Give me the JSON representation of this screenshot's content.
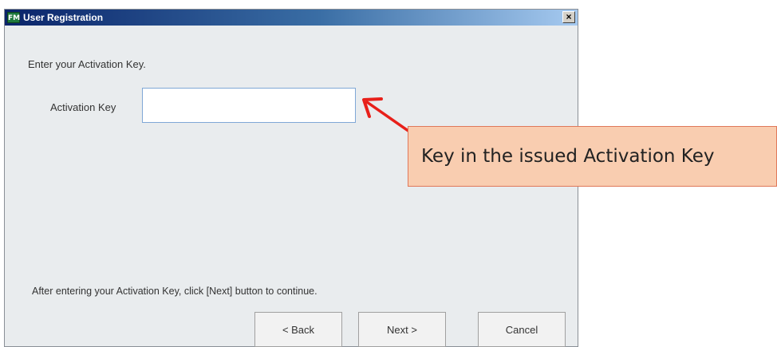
{
  "window": {
    "title": "User Registration",
    "app_icon_text": "FM",
    "close_glyph": "×"
  },
  "instruction": "Enter your Activation Key.",
  "activation_key": {
    "label": "Activation Key",
    "value": ""
  },
  "footer_text": "After entering your Activation Key, click [Next] button to continue.",
  "buttons": {
    "back": "< Back",
    "next": "Next >",
    "cancel": "Cancel"
  },
  "callout": {
    "text": "Key in the issued Activation Key",
    "fill_color": "#f9cdb0",
    "arrow_color": "#e8201a"
  }
}
